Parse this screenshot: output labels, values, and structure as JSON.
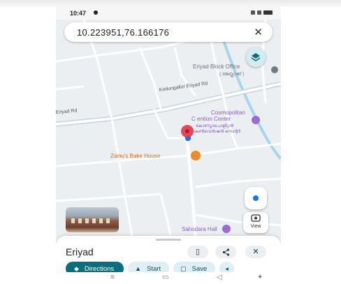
{
  "status": {
    "time": "10:47"
  },
  "search": {
    "query": "10.223951,76.166176",
    "clear_icon": "close-icon"
  },
  "map_labels": {
    "eriyad_block_office": "Eriyad Block Office",
    "eriyad_block_office_ml": "( ഒബ്ലോക്ക് )",
    "kodungallur_road": "Kodungallur Eriyad Rd",
    "eriyad_rd": "Eriyad Rd",
    "convention_center_1": "Cosmopolitan",
    "convention_center_2": "C  ention Center",
    "convention_center_ml1": "കോസ്മോപൊളിറ്റൻ",
    "convention_center_ml2": "കൺവെൻഷൻ സെന്റർ",
    "bakery": "Zainu's Bake House",
    "sahodara_hall": "Sahodara Hall"
  },
  "map_colors": {
    "water": "#a6d6ee",
    "road": "#ffffff",
    "primary_road": "#c9d2dc",
    "accent": "#0b6e7d",
    "pin": "#e8334a",
    "poi_purple": "#9c6ad6",
    "poi_orange": "#f08a24"
  },
  "controls": {
    "view_label": "View"
  },
  "sheet": {
    "place_name": "Eriyad",
    "directions_label": "Directions",
    "start_label": "Start",
    "save_label": "Save"
  }
}
